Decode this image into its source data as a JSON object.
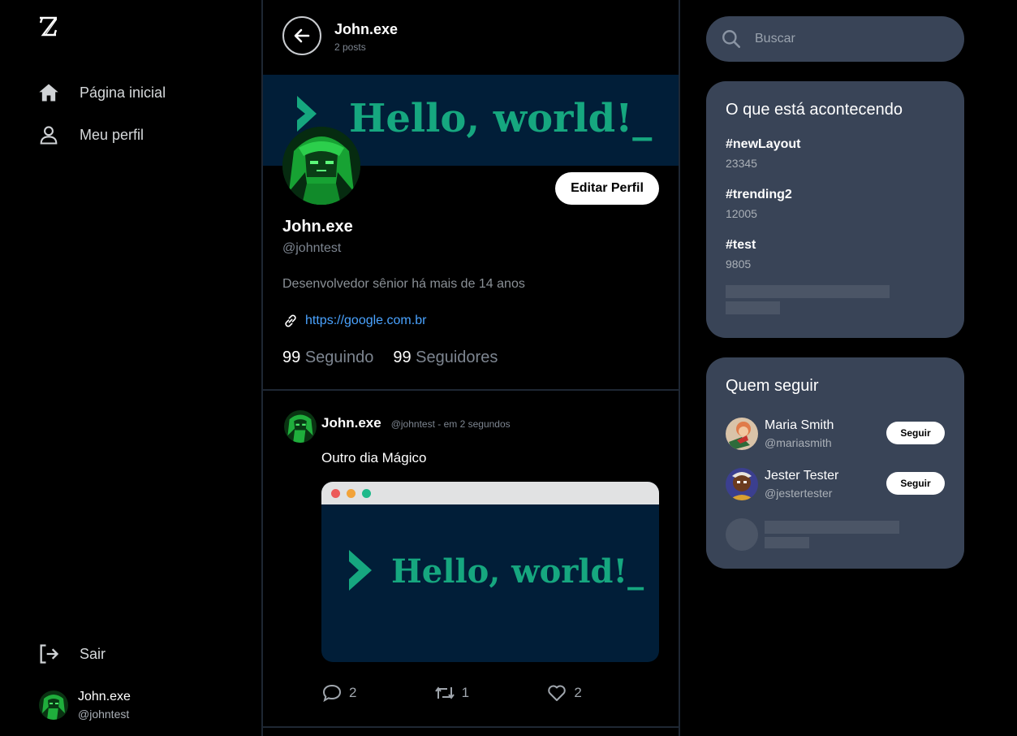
{
  "sidebar": {
    "logo": "Z",
    "nav": [
      {
        "label": "Página inicial",
        "icon": "home-icon"
      },
      {
        "label": "Meu perfil",
        "icon": "user-icon"
      }
    ],
    "logout_label": "Sair",
    "me": {
      "name": "John.exe",
      "handle": "@johntest"
    }
  },
  "header": {
    "title": "John.exe",
    "subtitle": "2 posts"
  },
  "banner": {
    "text": "Hello, world!_",
    "background": "#011e38",
    "accent": "#16a77f"
  },
  "profile": {
    "edit_label": "Editar Perfil",
    "name": "John.exe",
    "handle": "@johntest",
    "bio": "Desenvolvedor sênior há mais de 14 anos",
    "link": "https://google.com.br",
    "following_count": "99",
    "following_label": "Seguindo",
    "followers_count": "99",
    "followers_label": "Seguidores"
  },
  "post": {
    "name": "John.exe",
    "meta": "@johntest - em 2 segundos",
    "text": "Outro dia Mágico",
    "image_text": "Hello, world!_",
    "comments": "2",
    "retweets": "1",
    "likes": "2"
  },
  "search": {
    "placeholder": "Buscar"
  },
  "trends": {
    "title": "O que está acontecendo",
    "items": [
      {
        "tag": "#newLayout",
        "count": "23345"
      },
      {
        "tag": "#trending2",
        "count": "12005"
      },
      {
        "tag": "#test",
        "count": "9805"
      }
    ]
  },
  "who_to_follow": {
    "title": "Quem seguir",
    "follow_label": "Seguir",
    "users": [
      {
        "name": "Maria Smith",
        "handle": "@mariasmith"
      },
      {
        "name": "Jester Tester",
        "handle": "@jestertester"
      }
    ]
  },
  "colors": {
    "panel": "#394457",
    "link": "#4aa3ff",
    "divider": "#1e2733"
  }
}
